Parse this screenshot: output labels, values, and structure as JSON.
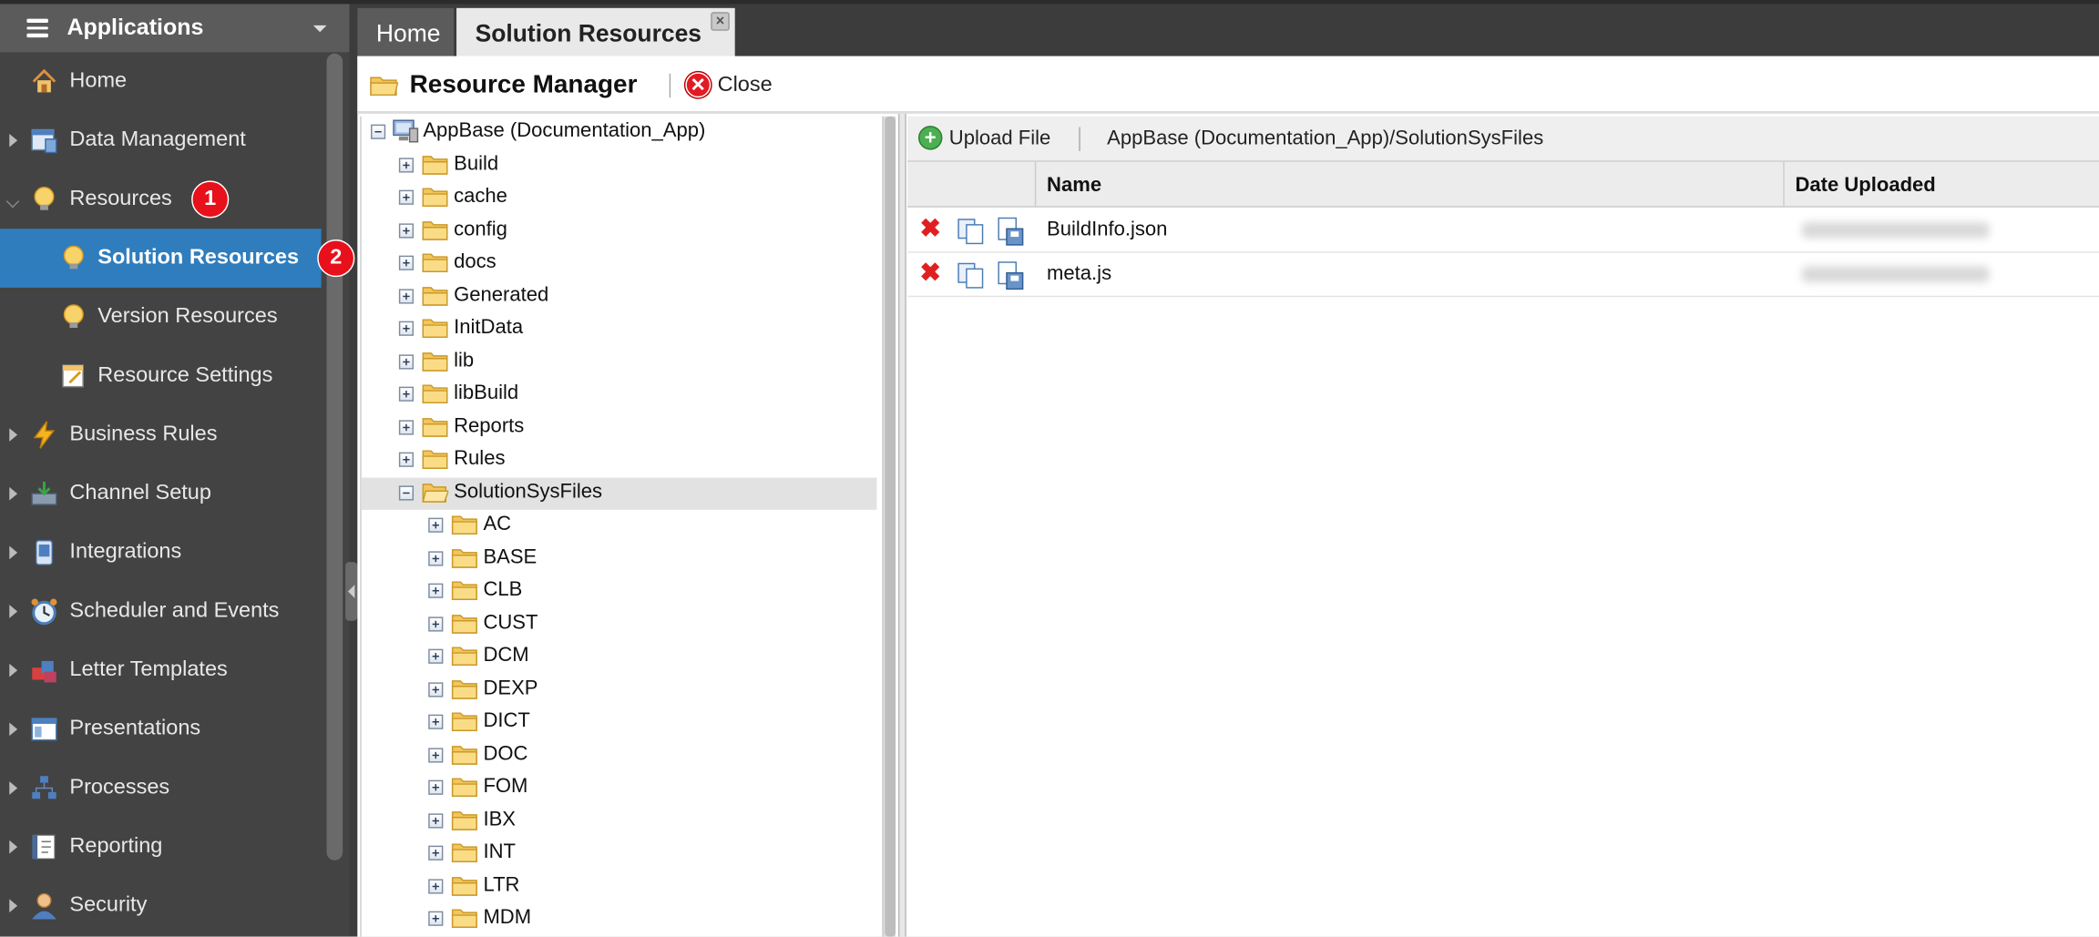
{
  "sidebar": {
    "header": "Applications",
    "items": [
      {
        "label": "Home"
      },
      {
        "label": "Data Management"
      },
      {
        "label": "Resources"
      },
      {
        "label": "Solution Resources"
      },
      {
        "label": "Version Resources"
      },
      {
        "label": "Resource Settings"
      },
      {
        "label": "Business Rules"
      },
      {
        "label": "Channel Setup"
      },
      {
        "label": "Integrations"
      },
      {
        "label": "Scheduler and Events"
      },
      {
        "label": "Letter Templates"
      },
      {
        "label": "Presentations"
      },
      {
        "label": "Processes"
      },
      {
        "label": "Reporting"
      },
      {
        "label": "Security"
      }
    ],
    "badges": [
      "1",
      "2"
    ]
  },
  "tabs": {
    "home": "Home",
    "solution_resources": "Solution Resources"
  },
  "resource_manager": {
    "title": "Resource Manager",
    "close_label": "Close"
  },
  "tree": {
    "root": "AppBase (Documentation_App)",
    "folders": [
      "Build",
      "cache",
      "config",
      "docs",
      "Generated",
      "InitData",
      "lib",
      "libBuild",
      "Reports",
      "Rules",
      "SolutionSysFiles"
    ],
    "subfolders": [
      "AC",
      "BASE",
      "CLB",
      "CUST",
      "DCM",
      "DEXP",
      "DICT",
      "DOC",
      "FOM",
      "IBX",
      "INT",
      "LTR",
      "MDM"
    ]
  },
  "files": {
    "upload_label": "Upload File",
    "path": "AppBase (Documentation_App)/SolutionSysFiles",
    "columns": {
      "name": "Name",
      "date": "Date Uploaded"
    },
    "rows": [
      {
        "name": "BuildInfo.json"
      },
      {
        "name": "meta.js"
      }
    ]
  },
  "colors": {
    "active_nav": "#2f7dbd",
    "badge": "#e8101a",
    "sidebar_bg": "#434343"
  }
}
